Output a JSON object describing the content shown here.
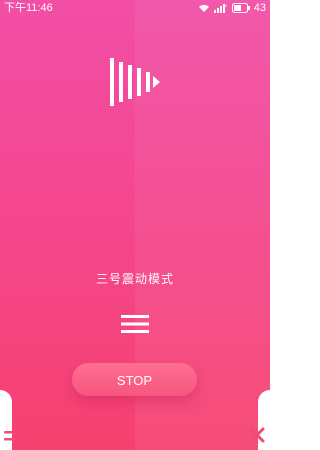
{
  "status_bar": {
    "time": "下午11:46",
    "battery_level": "43",
    "icons": [
      "wifi-icon",
      "signal-icon",
      "battery-icon"
    ]
  },
  "main": {
    "logo_icon": "vibration-logo-icon",
    "mode_label": "三号震动模式",
    "menu_icon": "hamburger-menu-icon"
  },
  "actions": {
    "stop_label": "STOP"
  },
  "bottom_bar": {
    "left_icon": "menu-icon",
    "right_icon": "close-icon"
  },
  "colors": {
    "background_top": "#f24ea6",
    "background_bottom": "#f6416f",
    "close_icon": "#f04a7a",
    "menu_icon_bottom": "#f04a7a"
  }
}
